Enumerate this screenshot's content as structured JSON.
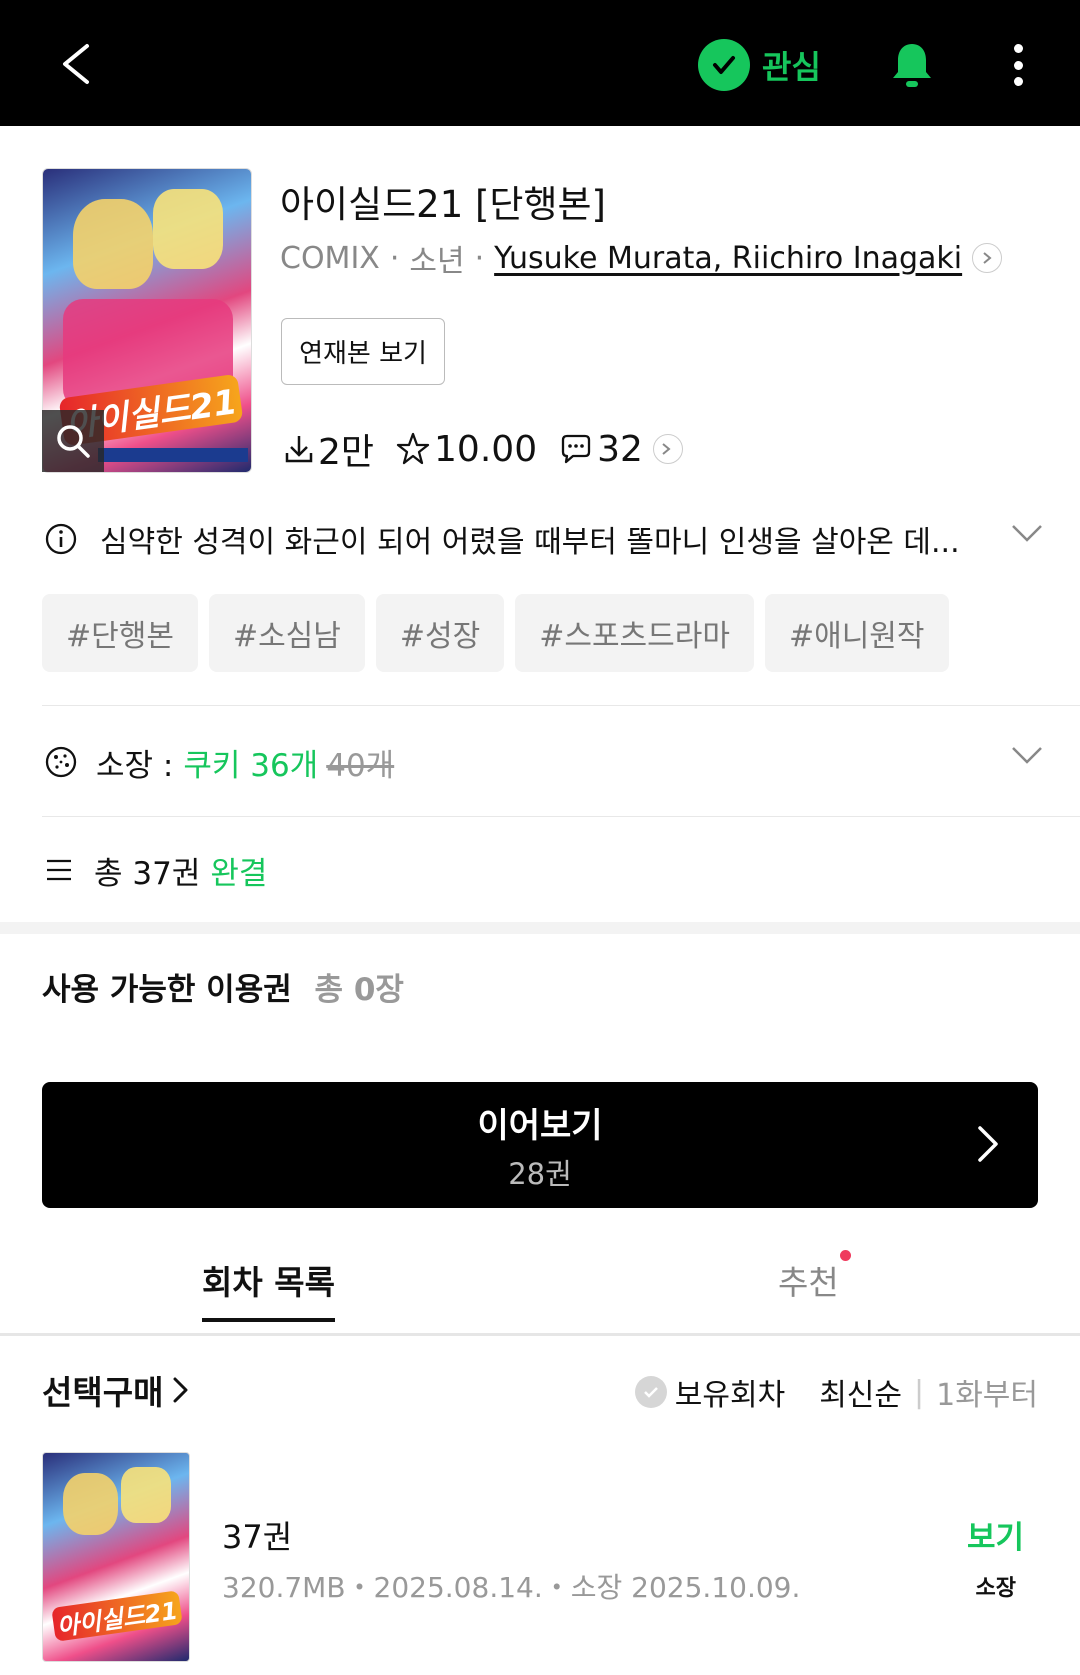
{
  "header": {
    "back_icon": "chevron-left-icon",
    "favorite_label": "관심",
    "bell_icon": "bell-icon",
    "more_icon": "more-vertical-icon",
    "accent_color": "#16c65c"
  },
  "work": {
    "cover_logo_text": "아이실드21",
    "title": "아이실드21 [단행본]",
    "publisher": "COMIX",
    "genre": "소년",
    "authors": "Yusuke Murata, Riichiro Inagaki",
    "serial_button": "연재본 보기",
    "downloads": "2만",
    "rating": "10.00",
    "comments": "32"
  },
  "synopsis": {
    "text": "심약한 성격이 화근이 되어 어렸을 때부터 똘마니 인생을 살아온 데..."
  },
  "tags": [
    "#단행본",
    "#소심남",
    "#성장",
    "#스포츠드라마",
    "#애니원작"
  ],
  "ownership": {
    "label": "소장 :",
    "cookie_price": "쿠키 36개",
    "original_price": "40개"
  },
  "volumes": {
    "total": "총 37권",
    "status": "완결"
  },
  "pass": {
    "label": "사용 가능한 이용권",
    "count": "총 0장"
  },
  "continue": {
    "title": "이어보기",
    "subtitle": "28권"
  },
  "tabs": [
    {
      "label": "회차 목록",
      "active": true
    },
    {
      "label": "추천",
      "active": false,
      "has_dot": true
    }
  ],
  "list_header": {
    "select_buy": "선택구매",
    "owned_filter": "보유회차",
    "sort_newest": "최신순",
    "sort_first": "1화부터"
  },
  "episodes": [
    {
      "thumb_logo": "아이실드21",
      "title": "37권",
      "info": "320.7MB・2025.08.14.・소장 2025.10.09.",
      "action": "보기",
      "status": "소장"
    }
  ]
}
